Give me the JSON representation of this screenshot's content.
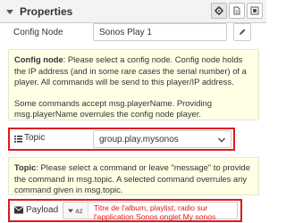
{
  "header": {
    "title": "Properties",
    "icons": [
      "settings-icon",
      "description-icon",
      "appearance-icon"
    ]
  },
  "config_node": {
    "label": "Config Node",
    "value": "Sonos Play 1"
  },
  "config_tip": {
    "bold": "Config node",
    "text": ": Please select a config node. Config node holds the IP address (and in some rare cases the serial number) of a player. All commands will be send to this player/IP address.",
    "text2": "Some commands accept msg.playerName. Providing msg.playerName overrules the config node player."
  },
  "topic": {
    "label": "Topic",
    "value": "group.play.mysonos"
  },
  "topic_tip": {
    "bold": "Topic",
    "text": ": Please select a command or leave \"message\" to provide the command in msg.topic. A selected command overrules any command given in msg.topic."
  },
  "payload": {
    "label": "Payload",
    "type_label": "az",
    "annotation": "Titre de l'album, playlist, radio sur l'application Sonos onglet My sonos"
  },
  "colors": {
    "highlight": "#e11919",
    "tip_bg": "#ffffe6"
  }
}
